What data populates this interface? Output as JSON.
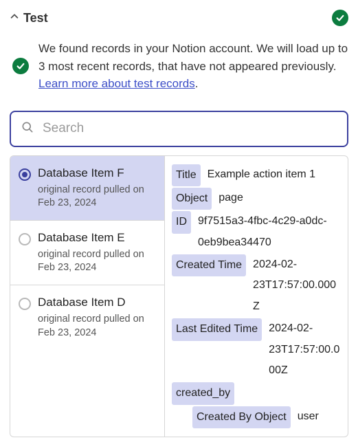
{
  "header": {
    "title": "Test"
  },
  "info": {
    "text_before": "We found records in your Notion account. We will load up to 3 most recent records, that have not appeared previously. ",
    "link_text": "Learn more about test records",
    "text_after": "."
  },
  "search": {
    "placeholder": "Search"
  },
  "records": [
    {
      "title": "Database Item F",
      "subtitle": "original record pulled on Feb 23, 2024",
      "selected": true
    },
    {
      "title": "Database Item E",
      "subtitle": "original record pulled on Feb 23, 2024",
      "selected": false
    },
    {
      "title": "Database Item D",
      "subtitle": "original record pulled on Feb 23, 2024",
      "selected": false
    }
  ],
  "details": {
    "title_key": "Title",
    "title_val": "Example action item 1",
    "object_key": "Object",
    "object_val": "page",
    "id_key": "ID",
    "id_val": "9f7515a3-4fbc-4c29-a0dc-0eb9bea34470",
    "created_key": "Created Time",
    "created_val": "2024-02-23T17:57:00.000Z",
    "edited_key": "Last Edited Time",
    "edited_val": "2024-02-23T17:57:00.000Z",
    "createdby_key": "created_by",
    "createdby_object_key": "Created By Object",
    "createdby_object_val": "user"
  }
}
